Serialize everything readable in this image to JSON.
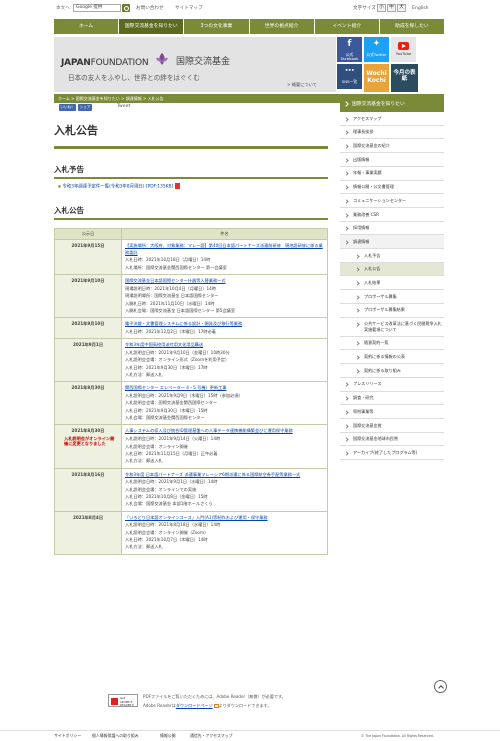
{
  "util": {
    "main_link": "本文へ",
    "search_value": "Google 提供",
    "u1": "お問い合わせ",
    "u2": "サイトマップ",
    "font_size_label": "文字サイズ",
    "font_small": "小",
    "font_mid": "中",
    "font_large": "大",
    "english": "English"
  },
  "nav": [
    "ホーム",
    "国際交流基金を知りたい",
    "3つの文化事業",
    "世界の拠点紹介",
    "イベント紹介",
    "助成を探したい"
  ],
  "banner": {
    "logo_en_bold": "JAPAN",
    "logo_en_thin": "FOUNDATION",
    "logo_jp": "国際交流基金",
    "tagline": "日本の友人をふやし、世界との絆をはぐくむ",
    "about": "> 概要について"
  },
  "social": {
    "fb": "公式Facebook",
    "tw": "公式Twitter",
    "yt": "YouTube",
    "sns": "SNS一覧",
    "wbox": "Wochi Kochi",
    "kyou": "今月の表紙"
  },
  "breadcrumb": [
    "ホーム",
    "国際交流基金を知りたい",
    "調達情報",
    "入札公告"
  ],
  "share": {
    "like": "いいね！ 1",
    "share": "シェア",
    "tweet": "Tweet"
  },
  "title": "入札公告",
  "yokoku": {
    "heading": "入札予告",
    "item": "令和3年調達予定件一覧(令和3年8月現在) [PDF:135KB]"
  },
  "koukoku": {
    "heading": "入札公告",
    "col_date": "公示日",
    "col_subject": "件名",
    "rows": [
      {
        "date": "2021年9月15日",
        "title": "【実施場所：大阪府、対象業務：マレー語】第40回日本語パートナーズ派遣前研修　現地語研修に係る業務委託",
        "lines": [
          "入札日時：2021年10月18日（月曜日）14時",
          "入札場所：国際交流基金関西国際センター 第一会議室"
        ]
      },
      {
        "date": "2021年9月10日",
        "title": "国際交流基金日本語国際センター什器等入替業務一式",
        "lines": [
          "現場説明日時：2021年10月4日（月曜日）14時",
          "現場説明場所：国際交流基金 日本語国際センター",
          "入開札日時：2021年11月10日（水曜日）14時",
          "入開札会場：国際交流基金 日本語国際センター 第5会議室"
        ]
      },
      {
        "date": "2021年9月10日",
        "title": "電子決裁・文書管理システムに係る設計・開発及び移行等業務",
        "lines": [
          "入札日時：2021年12月2日（木曜日）17時必着"
        ]
      },
      {
        "date": "2021年9月1日",
        "title": "令和3年度中国高校用送付用文化用品購送",
        "lines": [
          "入札説明会日時：2021年9月10日（金曜日）10時30分",
          "入札説明会会場：オンライン形式（Zoomを利用予定）",
          "入札日時：2021年9月30日（木曜日）17時",
          "入札方法：郵送入札"
        ]
      },
      {
        "date": "2021年8月30日",
        "title": "関西国際センター エレベーター 4・5 号機）更新工事",
        "lines": [
          "入札説明会日時：2021年9月9日（木曜日）15時（参加必須）",
          "入札説明会会場：国際交流基金関西国際センター",
          "入札日時：2021年9月30日（木曜日）15時",
          "入札会場：国際交流基金関西国際センター"
        ]
      },
      {
        "date": "2021年8月30日",
        "note": "入札説明会がオンライン開催に変更となりました",
        "title": "人事システムの導入及び統合ID管理基盤への人事データ連携機能構築並びに運用保守業務",
        "lines": [
          "入札説明会日時：2021年9月14日（火曜日）14時",
          "入札説明会会場：オンライン開催",
          "入札日時：2021年11月15日（月曜日）正午必着",
          "入札方法：郵送入札"
        ]
      },
      {
        "date": "2021年8月16日",
        "title": "令和3年度 日本語パートナーズ 派遣事業マレーシア6期派遣に係る国際航空券手配等業務一式",
        "lines": [
          "入札説明会日時：2021年9月1日（水曜日）14時",
          "入札説明会会場：オンラインでの実施",
          "入札日時：2021年10月8日（金曜日）15時",
          "入札会場：国際交流基金 本部1階ホールさくら"
        ]
      },
      {
        "date": "2021年8月4日",
        "title": "「いろどり日本語オンラインコース」入門(A1)等制作および運用・保守業務",
        "lines": [
          "入札説明会日時：2021年8月18日（水曜日）14時",
          "入札説明会会場：オンライン開催（Zoom）",
          "入札日時：2021年10月7日（木曜日）14時",
          "入札方法：郵送入札"
        ]
      }
    ]
  },
  "adobe": {
    "logo_line1": "Get",
    "logo_line2": "ADOBE® READER®",
    "text1": "PDFファイルをご覧いただくためには、Adobe Reader（無償）が必要です。",
    "text2_pre": "Adobe Readerは",
    "text2_link": "ダウンロードページ",
    "text2_post": "よりダウンロードできます。"
  },
  "sidebar": {
    "heading": "国際交流基金を知りたい",
    "items": [
      {
        "label": "アクセスマップ",
        "level": 1
      },
      {
        "label": "理事長挨拶",
        "level": 1
      },
      {
        "label": "国際交流基金の紹介",
        "level": 1
      },
      {
        "label": "出版情報",
        "level": 1
      },
      {
        "label": "年報・事業実績",
        "level": 1
      },
      {
        "label": "情報公開・公文書管理",
        "level": 1
      },
      {
        "label": "コミュニケーションセンター",
        "level": 1
      },
      {
        "label": "業務改善 CSR",
        "level": 1
      },
      {
        "label": "採用情報",
        "level": 1
      },
      {
        "label": "調達情報",
        "level": 1,
        "open": true
      },
      {
        "label": "入札予告",
        "level": 2
      },
      {
        "label": "入札公告",
        "level": 2,
        "active": true
      },
      {
        "label": "入札結果",
        "level": 2
      },
      {
        "label": "プロポーザル募集",
        "level": 2
      },
      {
        "label": "プロポーザル募集結果",
        "level": 2
      },
      {
        "label": "公共サービス改革法に基づく民間競争入札実施要項について",
        "level": 2
      },
      {
        "label": "随意契約一覧",
        "level": 2
      },
      {
        "label": "契約に係る情報の公表",
        "level": 2
      },
      {
        "label": "契約に係る取り組み",
        "level": 2
      },
      {
        "label": "プレスリリース",
        "level": 1
      },
      {
        "label": "調査・研究",
        "level": 1
      },
      {
        "label": "寄附事業等",
        "level": 1
      },
      {
        "label": "国際交流基金賞",
        "level": 1
      },
      {
        "label": "国際交流基金地球市民賞",
        "level": 1
      },
      {
        "label": "アーカイブ(終了したプログラム等)",
        "level": 1
      }
    ]
  },
  "footer": {
    "links": [
      "サイトポリシー",
      "個人情報保護への取り組み",
      "情報公開",
      "通信先・アクセスマップ"
    ],
    "copyright": "© The Japan Foundation. All Rights Reserved."
  }
}
